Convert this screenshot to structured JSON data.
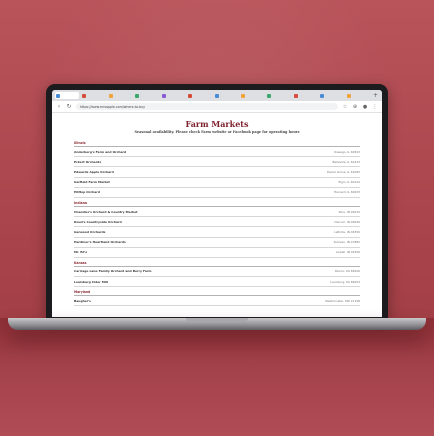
{
  "browser": {
    "tabs": [
      {
        "title": "",
        "color": "#4a8bd6"
      },
      {
        "title": "",
        "color": "#d84a3a"
      },
      {
        "title": "",
        "color": "#f2a33a"
      },
      {
        "title": "",
        "color": "#3aa76d"
      },
      {
        "title": "",
        "color": "#8a5bd6"
      },
      {
        "title": "",
        "color": "#d84a3a"
      },
      {
        "title": "",
        "color": "#4a8bd6"
      },
      {
        "title": "",
        "color": "#f2a33a"
      },
      {
        "title": "",
        "color": "#3aa76d"
      },
      {
        "title": "",
        "color": "#d84a3a"
      },
      {
        "title": "",
        "color": "#4a8bd6"
      },
      {
        "title": "",
        "color": "#f2a33a"
      }
    ],
    "url": "https://www.mrsapple.com/where-to-buy"
  },
  "page": {
    "title": "Farm Markets",
    "subtitle": "Seasonal availability. Please check Farm website or Facebook page for operating hours",
    "sections": [
      {
        "name": "Illinois",
        "rows": [
          {
            "name": "Anderberg's Farm and Orchard",
            "location": "Oswego, IL 60543"
          },
          {
            "name": "Eckert Orchards",
            "location": "Belleville, IL 62223"
          },
          {
            "name": "Edwards Apple Orchard",
            "location": "Poplar Grove, IL 61065"
          },
          {
            "name": "Garfield Farm Market",
            "location": "Elgin, IL 60124"
          },
          {
            "name": "Hilltop Orchard",
            "location": "Harvard, IL 60033"
          }
        ]
      },
      {
        "name": "Indiana",
        "rows": [
          {
            "name": "Chandler's Orchard & Country Market",
            "location": "Peru, IN 46970"
          },
          {
            "name": "Doud's Countryside Orchard",
            "location": "Denver, IN 46926"
          },
          {
            "name": "Garwood Orchards",
            "location": "LaPorte, IN 46350"
          },
          {
            "name": "Hardiner's Heartland Orchards",
            "location": "Sullivan, IN 47882"
          },
          {
            "name": "Mr. Ed's",
            "location": "Lowell, IN 46356"
          }
        ]
      },
      {
        "name": "Kansas",
        "rows": [
          {
            "name": "Carriage Lane Family Orchard and Berry Farm",
            "location": "Paxico, KS 66526"
          },
          {
            "name": "Louisburg Cider Mill",
            "location": "Louisburg, KS 66053"
          }
        ]
      },
      {
        "name": "Maryland",
        "rows": [
          {
            "name": "Baugher's",
            "location": "Westminster, MD 21158"
          }
        ]
      }
    ]
  }
}
